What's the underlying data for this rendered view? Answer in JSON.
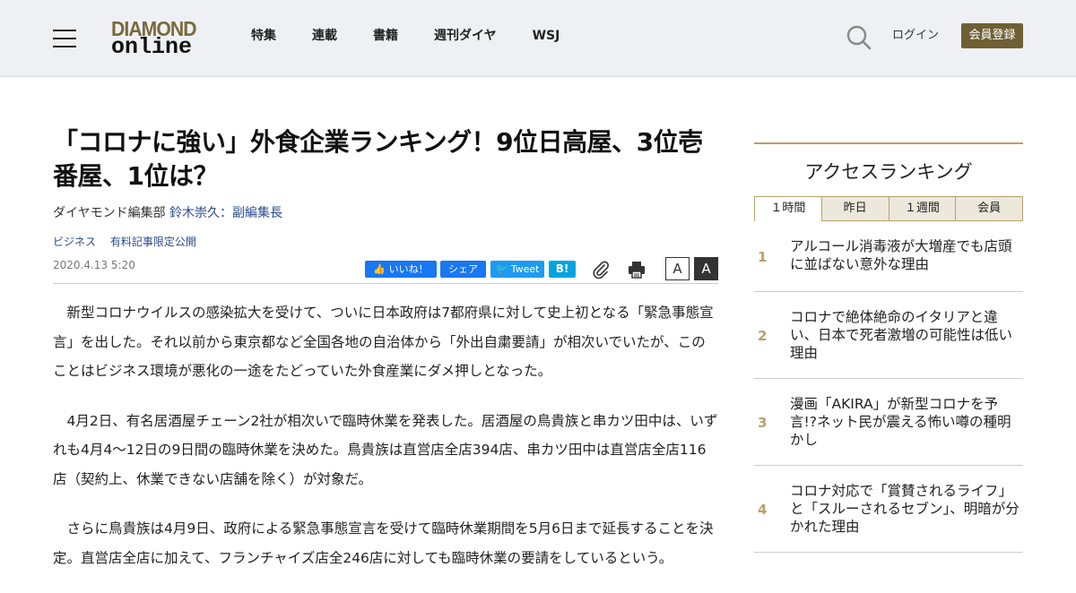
{
  "header": {
    "logo_top": "DIAMOND",
    "logo_bottom": "online",
    "nav": [
      "特集",
      "連載",
      "書籍",
      "週刊ダイヤ",
      "WSJ"
    ],
    "login": "ログイン",
    "register": "会員登録"
  },
  "article": {
    "title": "「コロナに強い」外食企業ランキング！9位日高屋、3位壱番屋、1位は？",
    "byline_prefix": "ダイヤモンド編集部",
    "author": "鈴木崇久：副編集長",
    "tags": [
      "ビジネス",
      "有料記事限定公開"
    ],
    "date": "2020.4.13 5:20",
    "share": {
      "like": "いいね！",
      "fb_share": "シェア",
      "tweet": "Tweet",
      "hatena": "B!"
    },
    "font_small": "A",
    "font_large": "A",
    "paragraphs": [
      "新型コロナウイルスの感染拡大を受けて、ついに日本政府は7都府県に対して史上初となる「緊急事態宣言」を出した。それ以前から東京都など全国各地の自治体から「外出自粛要請」が相次いでいたが、このことはビジネス環境が悪化の一途をたどっていた外食産業にダメ押しとなった。",
      "4月2日、有名居酒屋チェーン2社が相次いで臨時休業を発表した。居酒屋の鳥貴族と串カツ田中は、いずれも4月4～12日の9日間の臨時休業を決めた。鳥貴族は直営店全店394店、串カツ田中は直営店全店116店（契約上、休業できない店舗を除く）が対象だ。",
      "さらに鳥貴族は4月9日、政府による緊急事態宣言を受けて臨時休業期間を5月6日まで延長することを決定。直営店全店に加えて、フランチャイズ店全246店に対しても臨時休業の要請をしているという。"
    ]
  },
  "sidebar": {
    "title": "アクセスランキング",
    "tabs": [
      "１時間",
      "昨日",
      "１週間",
      "会員"
    ],
    "items": [
      {
        "rank": "1",
        "text": "アルコール消毒液が大増産でも店頭に並ばない意外な理由"
      },
      {
        "rank": "2",
        "text": "コロナで絶体絶命のイタリアと違い、日本で死者激増の可能性は低い理由"
      },
      {
        "rank": "3",
        "text": "漫画「AKIRA」が新型コロナを予言!?ネット民が震える怖い噂の種明かし"
      },
      {
        "rank": "4",
        "text": "コロナ対応で「賞賛されるライフ」と「スルーされるセブン」、明暗が分かれた理由"
      }
    ]
  }
}
